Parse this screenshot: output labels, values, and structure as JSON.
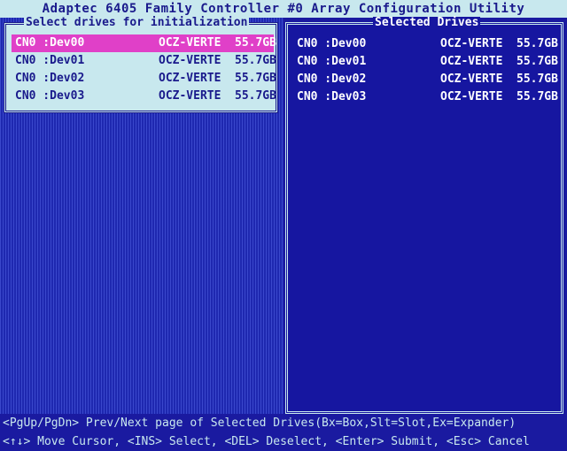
{
  "title": "Adaptec 6405 Family Controller #0 Array Configuration Utility",
  "left_panel": {
    "title": "Select drives for initialization",
    "drives": [
      {
        "port": "CN0 :Dev00",
        "model": "OCZ-VERTE",
        "size": "55.7GB",
        "selected": true
      },
      {
        "port": "CN0 :Dev01",
        "model": "OCZ-VERTE",
        "size": "55.7GB",
        "selected": false
      },
      {
        "port": "CN0 :Dev02",
        "model": "OCZ-VERTE",
        "size": "55.7GB",
        "selected": false
      },
      {
        "port": "CN0 :Dev03",
        "model": "OCZ-VERTE",
        "size": "55.7GB",
        "selected": false
      }
    ]
  },
  "right_panel": {
    "title": "Selected Drives",
    "drives": [
      {
        "port": "CN0 :Dev00",
        "model": "OCZ-VERTE",
        "size": "55.7GB"
      },
      {
        "port": "CN0 :Dev01",
        "model": "OCZ-VERTE",
        "size": "55.7GB"
      },
      {
        "port": "CN0 :Dev02",
        "model": "OCZ-VERTE",
        "size": "55.7GB"
      },
      {
        "port": "CN0 :Dev03",
        "model": "OCZ-VERTE",
        "size": "55.7GB"
      }
    ]
  },
  "footer": {
    "line1": "<PgUp/PgDn> Prev/Next page of Selected Drives(Bx=Box,Slt=Slot,Ex=Expander)",
    "line2": "<↑↓> Move Cursor, <INS> Select, <DEL> Deselect, <Enter> Submit, <Esc> Cancel"
  },
  "colors": {
    "background": "#1a1aa0",
    "panel_light": "#c8e8ee",
    "highlight": "#e040c8",
    "text_dark": "#1a1a8c",
    "text_light": "#ffffff"
  }
}
